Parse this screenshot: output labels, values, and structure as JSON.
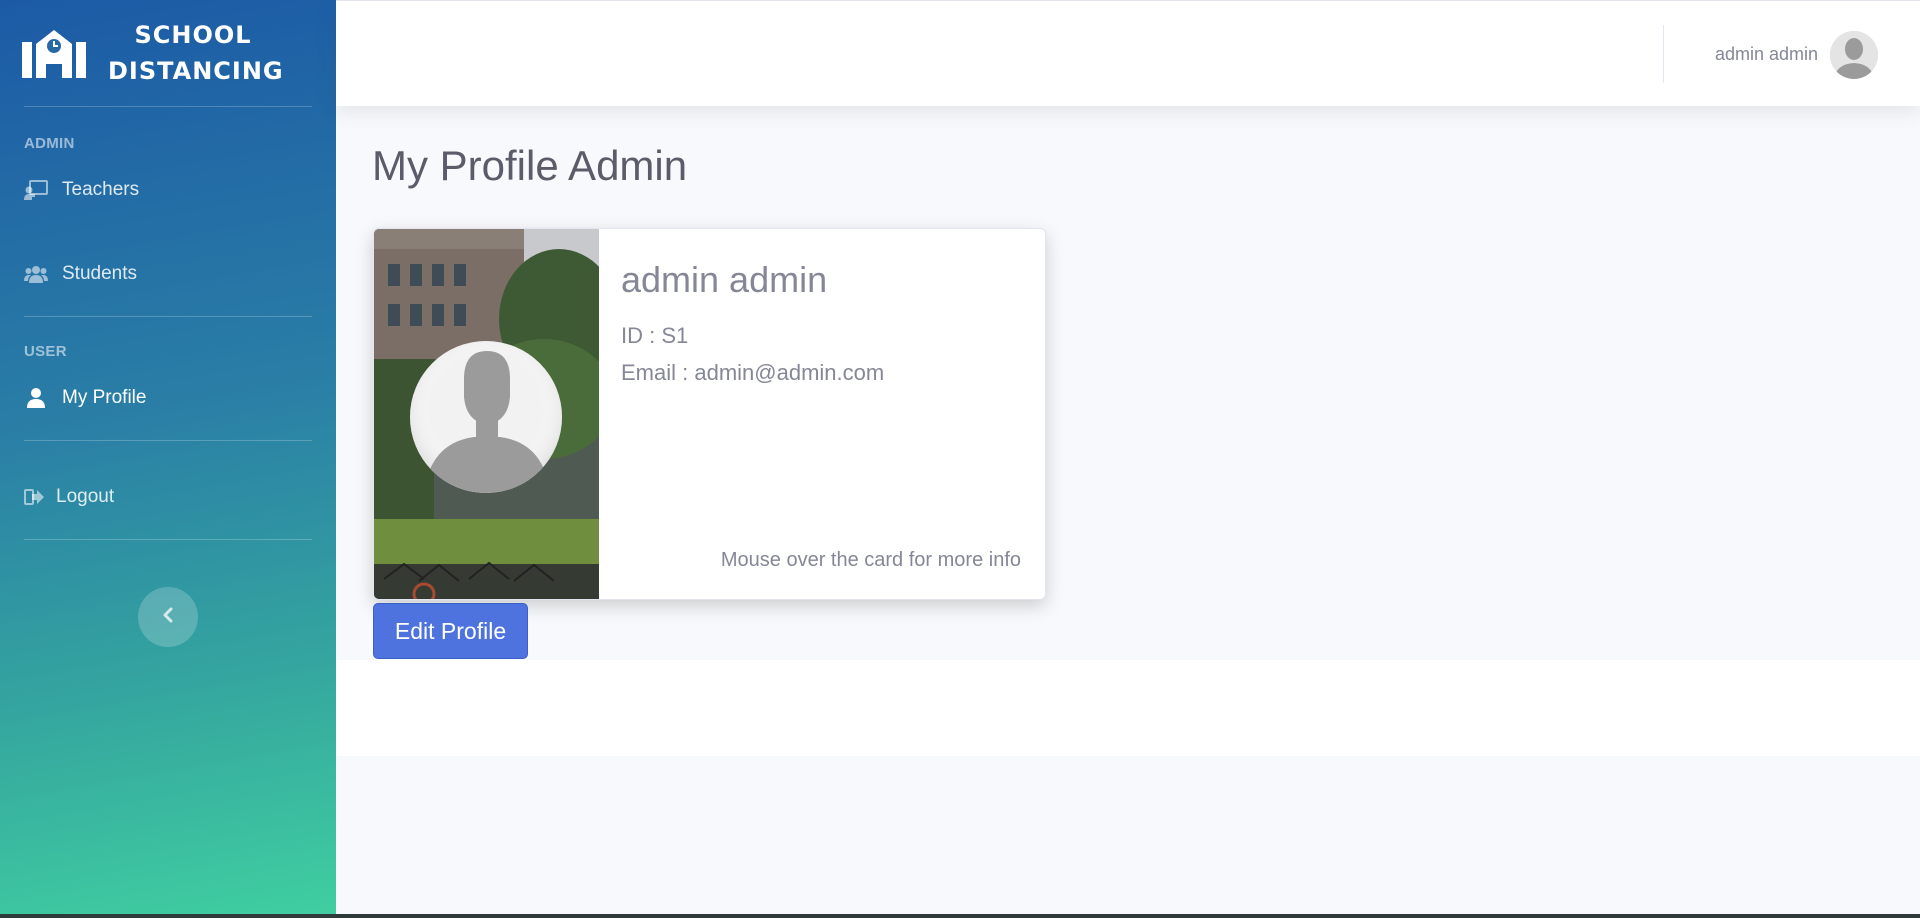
{
  "app": {
    "brand_line1": "SCHOOL",
    "brand_line2": "DISTANCING",
    "brand_icon": "school-building-icon"
  },
  "sidebar": {
    "sections": [
      {
        "heading": "ADMIN",
        "items": [
          {
            "label": "Teachers",
            "icon": "chalkboard-teacher-icon"
          },
          {
            "label": "Students",
            "icon": "users-icon"
          }
        ]
      },
      {
        "heading": "USER",
        "items": [
          {
            "label": "My Profile",
            "icon": "user-icon",
            "active": true
          }
        ]
      }
    ],
    "logout_label": "Logout",
    "toggle_icon": "chevron-left-icon"
  },
  "topbar": {
    "user_name": "admin admin",
    "avatar_icon": "user-avatar-icon"
  },
  "page": {
    "title": "My Profile Admin"
  },
  "profile_card": {
    "name": "admin admin",
    "id_text": "ID : S1",
    "email_text": "Email : admin@admin.com",
    "hint": "Mouse over the card for more info"
  },
  "actions": {
    "edit_profile_label": "Edit Profile"
  },
  "colors": {
    "primary": "#4e73df",
    "sidebar_top": "#1c5aa6",
    "sidebar_bottom": "#40cfa0",
    "text_muted": "#858796",
    "heading": "#5a5c69"
  }
}
